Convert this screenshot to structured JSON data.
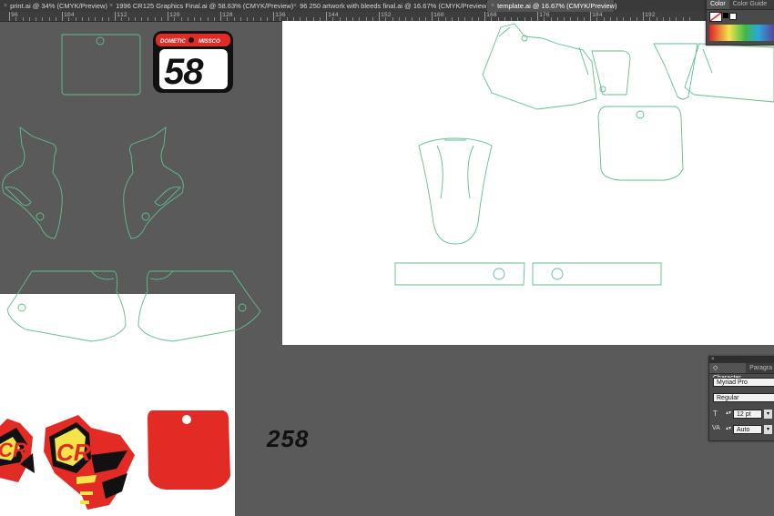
{
  "tabs": [
    {
      "label": "print.ai @ 34% (CMYK/Preview)",
      "active": false
    },
    {
      "label": "1996 CR125 Graphics Final.ai @ 58.63% (CMYK/Preview)",
      "active": false
    },
    {
      "label": "96 250 artwork with bleeds final.ai @ 16.67% (CMYK/Preview)",
      "active": false
    },
    {
      "label": "template.ai @ 16.67% (CMYK/Preview)",
      "active": true
    }
  ],
  "ruler": {
    "labels": [
      "96",
      "104",
      "112",
      "120",
      "128",
      "136",
      "144",
      "152",
      "160",
      "168",
      "176",
      "184",
      "192"
    ]
  },
  "artwork": {
    "plate_sponsors": [
      "DOMETIC",
      "MISSCO"
    ],
    "plate_number": "58",
    "loose_number": "258",
    "fender_text": "CR"
  },
  "color_panel": {
    "tabs": [
      "Color",
      "Color Guide"
    ]
  },
  "character_panel": {
    "tabs": [
      "Character",
      "Paragra"
    ],
    "font_family": "Myriad Pro",
    "font_style": "Regular",
    "font_size": "12 pt",
    "tracking": "Auto"
  },
  "colors": {
    "outline": "#5fc08a",
    "red": "#e32b25",
    "yellow": "#f4e34a",
    "black": "#111111"
  }
}
